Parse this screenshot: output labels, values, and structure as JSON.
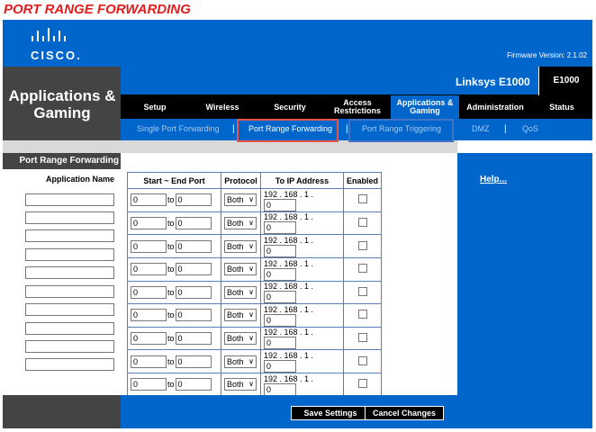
{
  "caption": "PORT RANGE FORWARDING",
  "header": {
    "logo_text": "CISCO.",
    "firmware": "Firmware Version: 2.1.02",
    "section_title": "Applications & Gaming",
    "product_name": "Linksys E1000",
    "model": "E1000"
  },
  "tabs": [
    {
      "label": "Setup"
    },
    {
      "label": "Wireless"
    },
    {
      "label": "Security"
    },
    {
      "label": "Access Restrictions"
    },
    {
      "label": "Applications & Gaming"
    },
    {
      "label": "Administration"
    },
    {
      "label": "Status"
    }
  ],
  "subtabs": {
    "single": "Single Port Forwarding",
    "range": "Port Range Forwarding",
    "triggering": "Port Range Triggering",
    "dmz": "DMZ",
    "qos": "QoS",
    "separator": "|"
  },
  "side": {
    "heading": "Port Range Forwarding",
    "app_name_label": "Application Name"
  },
  "table": {
    "headers": [
      "Start ~ End Port",
      "Protocol",
      "To IP Address",
      "Enabled"
    ],
    "to_label": "to",
    "ip_prefix": "192 . 168 . 1 .",
    "rows": [
      {
        "start": "0",
        "end": "0",
        "protocol": "Both",
        "ip_last": "0"
      },
      {
        "start": "0",
        "end": "0",
        "protocol": "Both",
        "ip_last": "0"
      },
      {
        "start": "0",
        "end": "0",
        "protocol": "Both",
        "ip_last": "0"
      },
      {
        "start": "0",
        "end": "0",
        "protocol": "Both",
        "ip_last": "0"
      },
      {
        "start": "0",
        "end": "0",
        "protocol": "Both",
        "ip_last": "0"
      },
      {
        "start": "0",
        "end": "0",
        "protocol": "Both",
        "ip_last": "0"
      },
      {
        "start": "0",
        "end": "0",
        "protocol": "Both",
        "ip_last": "0"
      },
      {
        "start": "0",
        "end": "0",
        "protocol": "Both",
        "ip_last": "0"
      },
      {
        "start": "0",
        "end": "0",
        "protocol": "Both",
        "ip_last": "0"
      },
      {
        "start": "0",
        "end": "0",
        "protocol": "Both",
        "ip_last": "0"
      }
    ]
  },
  "help_link": "Help...",
  "buttons": {
    "save": "Save Settings",
    "cancel": "Cancel Changes"
  }
}
